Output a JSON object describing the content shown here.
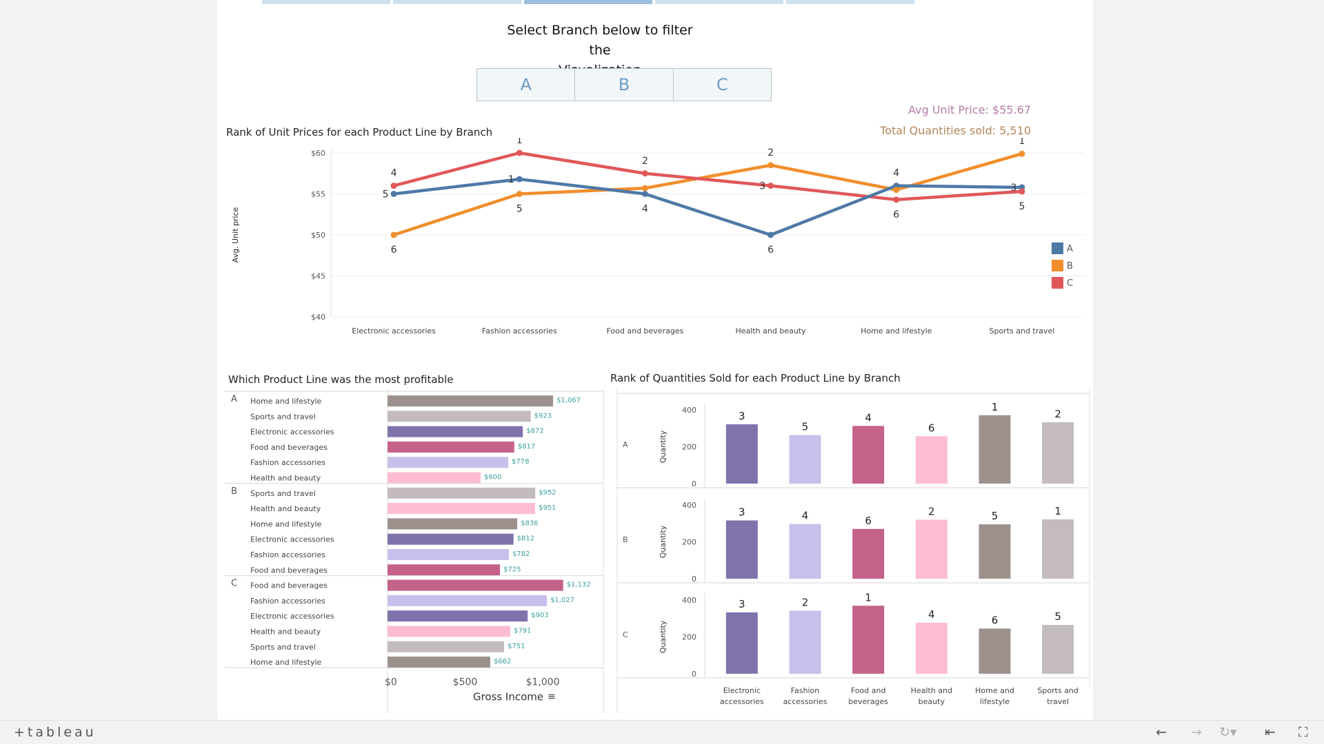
{
  "filter": {
    "title_line1": "Select Branch below to filter the",
    "title_line2": "Visualization",
    "buttons": [
      "A",
      "B",
      "C"
    ]
  },
  "kpi": {
    "avg_unit_price": "Avg Unit Price: $55.67",
    "total_quantities": "Total Quantities sold: 5,510"
  },
  "titles": {
    "rank_unit_prices": "Rank of Unit Prices for each Product Line by Branch",
    "most_profitable": "Which Product Line was the most profitable",
    "rank_quantities": "Rank of Quantities Sold for each Product Line by Branch"
  },
  "colors": {
    "A": "#4e79a7",
    "B": "#f28e2b",
    "C": "#e15759",
    "Electronic accessories": "#8073ac",
    "Fashion accessories": "#c7c0ec",
    "Food and beverages": "#c4628a",
    "Health and beauty": "#fdbcd2",
    "Home and lifestyle": "#9d918e",
    "Sports and travel": "#c4bcbc",
    "label_text": "#3b9e9e"
  },
  "footer": {
    "logo": "+tableau"
  },
  "chart_data": [
    {
      "type": "line",
      "title": "Rank of Unit Prices for each Product Line by Branch",
      "ylabel": "Avg. Unit price",
      "ylim": [
        40,
        60
      ],
      "yticks": [
        "$60",
        "$55",
        "$50",
        "$45",
        "$40"
      ],
      "categories": [
        "Electronic accessories",
        "Fashion accessories",
        "Food and beverages",
        "Health and beauty",
        "Home and lifestyle",
        "Sports and travel"
      ],
      "series": [
        {
          "name": "A",
          "values": [
            55.0,
            56.8,
            55.0,
            50.0,
            56.0,
            55.8
          ],
          "ranks": [
            "5",
            "1",
            "4",
            "6",
            "4",
            "3"
          ]
        },
        {
          "name": "B",
          "values": [
            50.0,
            55.0,
            55.7,
            58.5,
            55.5,
            59.9
          ],
          "ranks": [
            "6",
            "5",
            "",
            "2",
            "",
            "1"
          ]
        },
        {
          "name": "C",
          "values": [
            56.0,
            60.0,
            57.5,
            56.0,
            54.3,
            55.3
          ],
          "ranks": [
            "4",
            "1",
            "2",
            "3",
            "6",
            "5"
          ]
        }
      ],
      "legend": [
        "A",
        "B",
        "C"
      ],
      "legend_placement": "right",
      "grid": true
    },
    {
      "type": "bar",
      "title": "Which Product Line was the most profitable",
      "xlabel": "Gross Income",
      "xticks": [
        "$0",
        "$500",
        "$1,000"
      ],
      "xlim": [
        0,
        1400
      ],
      "groups": [
        {
          "branch": "A",
          "items": [
            {
              "line": "Home and lifestyle",
              "value": 1067,
              "label": "$1,067"
            },
            {
              "line": "Sports and travel",
              "value": 923,
              "label": "$923"
            },
            {
              "line": "Electronic accessories",
              "value": 872,
              "label": "$872"
            },
            {
              "line": "Food and beverages",
              "value": 817,
              "label": "$817"
            },
            {
              "line": "Fashion accessories",
              "value": 778,
              "label": "$778"
            },
            {
              "line": "Health and beauty",
              "value": 600,
              "label": "$600"
            }
          ]
        },
        {
          "branch": "B",
          "items": [
            {
              "line": "Sports and travel",
              "value": 952,
              "label": "$952"
            },
            {
              "line": "Health and beauty",
              "value": 951,
              "label": "$951"
            },
            {
              "line": "Home and lifestyle",
              "value": 836,
              "label": "$836"
            },
            {
              "line": "Electronic accessories",
              "value": 812,
              "label": "$812"
            },
            {
              "line": "Fashion accessories",
              "value": 782,
              "label": "$782"
            },
            {
              "line": "Food and beverages",
              "value": 725,
              "label": "$725"
            }
          ]
        },
        {
          "branch": "C",
          "items": [
            {
              "line": "Food and beverages",
              "value": 1132,
              "label": "$1,132"
            },
            {
              "line": "Fashion accessories",
              "value": 1027,
              "label": "$1,027"
            },
            {
              "line": "Electronic accessories",
              "value": 903,
              "label": "$903"
            },
            {
              "line": "Health and beauty",
              "value": 791,
              "label": "$791"
            },
            {
              "line": "Sports and travel",
              "value": 751,
              "label": "$751"
            },
            {
              "line": "Home and lifestyle",
              "value": 662,
              "label": "$662"
            }
          ]
        }
      ]
    },
    {
      "type": "bar",
      "title": "Rank of Quantities Sold for each Product Line by Branch",
      "ylabel": "Quantity",
      "ylim": [
        0,
        400
      ],
      "yticks": [
        "400",
        "200",
        "0"
      ],
      "categories": [
        "Electronic accessories",
        "Fashion accessories",
        "Food and beverages",
        "Health and beauty",
        "Home and lifestyle",
        "Sports and travel"
      ],
      "category_labels": [
        [
          "Electronic",
          "accessories"
        ],
        [
          "Fashion",
          "accessories"
        ],
        [
          "Food and",
          "beverages"
        ],
        [
          "Health and",
          "beauty"
        ],
        [
          "Home and",
          "lifestyle"
        ],
        [
          "Sports and",
          "travel"
        ]
      ],
      "rows": [
        {
          "branch": "A",
          "values": [
            322,
            263,
            313,
            257,
            371,
            333
          ],
          "ranks": [
            "3",
            "5",
            "4",
            "6",
            "1",
            "2"
          ]
        },
        {
          "branch": "B",
          "values": [
            316,
            297,
            270,
            320,
            295,
            322
          ],
          "ranks": [
            "3",
            "4",
            "6",
            "2",
            "5",
            "1"
          ]
        },
        {
          "branch": "C",
          "values": [
            333,
            342,
            369,
            277,
            245,
            265
          ],
          "ranks": [
            "3",
            "2",
            "1",
            "4",
            "6",
            "5"
          ]
        }
      ]
    }
  ]
}
